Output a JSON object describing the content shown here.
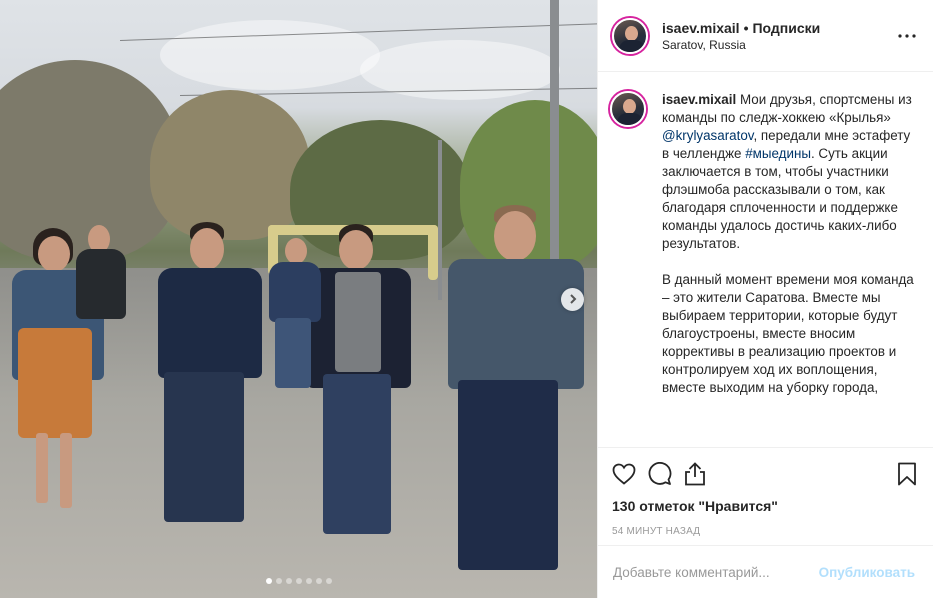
{
  "post": {
    "username": "isaev.mixail",
    "separator": "•",
    "follow_label": "Подписки",
    "location": "Saratov, Russia",
    "more_icon": "more-options-icon"
  },
  "caption": {
    "username": "isaev.mixail",
    "part1": "Мои друзья, спортсмены из команды по следж-хоккею «Крылья» ",
    "mention": "@krylyasaratov",
    "part2": ", передали мне эстафету в челлендже ",
    "hashtag": "#мыедины",
    "part3": ". Суть акции заключается в том, чтобы участники флэшмоба рассказывали о том, как благодаря сплоченности и поддержке команды удалось достичь каких-либо результатов.",
    "paragraph2": "В данный момент времени моя команда – это жители Саратова. Вместе мы выбираем территории, которые будут благоустроены, вместе вносим коррективы в реализацию проектов и контролируем ход их воплощения, вместе выходим на уборку города,"
  },
  "actions": {
    "like_icon": "heart-icon",
    "comment_icon": "comment-icon",
    "share_icon": "share-icon",
    "save_icon": "bookmark-icon",
    "likes_text": "130 отметок \"Нравится\"",
    "time_text": "54 МИНУТ НАЗАД"
  },
  "comment": {
    "placeholder": "Добавьте комментарий...",
    "publish_label": "Опубликовать"
  },
  "carousel": {
    "slide_count": 7,
    "active_index": 0
  },
  "colors": {
    "link": "#003569",
    "publish_disabled": "#b2dffc",
    "avatar_ring": "#d6249f"
  }
}
